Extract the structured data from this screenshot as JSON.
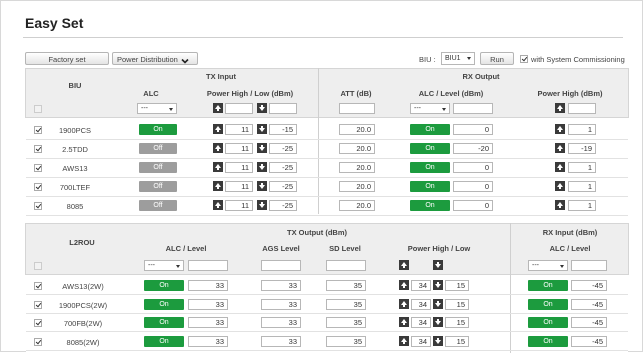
{
  "page": {
    "title": "Easy Set"
  },
  "toolbar": {
    "factory_set": "Factory set",
    "power_distribution": "Power Distribution",
    "biu_label": "BIU :",
    "biu_value": "BIU1",
    "run": "Run",
    "commissioning_label": "with System Commissioning",
    "commissioning_checked": true
  },
  "biu_table": {
    "row_header": "BIU",
    "tx_input": {
      "title": "TX Input",
      "alc": "ALC",
      "power": "Power High / Low (dBm)"
    },
    "rx_output": {
      "title": "RX Output",
      "att": "ATT (dB)",
      "alc_level": "ALC / Level (dBm)",
      "power_high": "Power High (dBm)"
    },
    "control_row": {
      "tx_alc_select": "---",
      "rx_alc_select": "---"
    },
    "rows": [
      {
        "name": "1900PCS",
        "checked": true,
        "tx_alc": "On",
        "tx_alc_on": true,
        "tx_high": "11",
        "tx_low": "-15",
        "att": "20.0",
        "rx_alc": "On",
        "rx_level": "0",
        "rx_high": "1"
      },
      {
        "name": "2.5TDD",
        "checked": true,
        "tx_alc": "Off",
        "tx_alc_on": false,
        "tx_high": "11",
        "tx_low": "-25",
        "att": "20.0",
        "rx_alc": "On",
        "rx_level": "-20",
        "rx_high": "-19"
      },
      {
        "name": "AWS13",
        "checked": true,
        "tx_alc": "Off",
        "tx_alc_on": false,
        "tx_high": "11",
        "tx_low": "-25",
        "att": "20.0",
        "rx_alc": "On",
        "rx_level": "0",
        "rx_high": "1"
      },
      {
        "name": "700LTEF",
        "checked": true,
        "tx_alc": "Off",
        "tx_alc_on": false,
        "tx_high": "11",
        "tx_low": "-25",
        "att": "20.0",
        "rx_alc": "On",
        "rx_level": "0",
        "rx_high": "1"
      },
      {
        "name": "8085",
        "checked": true,
        "tx_alc": "Off",
        "tx_alc_on": false,
        "tx_high": "11",
        "tx_low": "-25",
        "att": "20.0",
        "rx_alc": "On",
        "rx_level": "0",
        "rx_high": "1"
      }
    ]
  },
  "rou_table": {
    "row_header": "L2ROU",
    "tx_output": {
      "title": "TX Output (dBm)",
      "alc_level": "ALC / Level",
      "ags": "AGS Level",
      "sd": "SD Level",
      "power": "Power High / Low"
    },
    "rx_input": {
      "title": "RX Input (dBm)",
      "alc_level": "ALC / Level"
    },
    "control_row": {
      "tx_alc_select": "---",
      "rx_alc_select": "---",
      "power_high": "",
      "power_low": ""
    },
    "rows": [
      {
        "name": "AWS13(2W)",
        "checked": true,
        "tx_alc": "On",
        "tx_level": "33",
        "ags": "33",
        "sd": "35",
        "high": "34",
        "low": "15",
        "rx_alc": "On",
        "rx_level": "-45"
      },
      {
        "name": "1900PCS(2W)",
        "checked": true,
        "tx_alc": "On",
        "tx_level": "33",
        "ags": "33",
        "sd": "35",
        "high": "34",
        "low": "15",
        "rx_alc": "On",
        "rx_level": "-45"
      },
      {
        "name": "700FB(2W)",
        "checked": true,
        "tx_alc": "On",
        "tx_level": "33",
        "ags": "33",
        "sd": "35",
        "high": "34",
        "low": "15",
        "rx_alc": "On",
        "rx_level": "-45"
      },
      {
        "name": "8085(2W)",
        "checked": true,
        "tx_alc": "On",
        "tx_level": "33",
        "ags": "33",
        "sd": "35",
        "high": "34",
        "low": "15",
        "rx_alc": "On",
        "rx_level": "-45"
      }
    ]
  },
  "colors": {
    "on": "#1c9b3e",
    "off": "#9d9d9d",
    "header_bg": "#eeeeee"
  },
  "icons": {
    "up": "arrow-up-icon",
    "down": "arrow-down-icon",
    "dropdown": "chevron-down-icon"
  }
}
